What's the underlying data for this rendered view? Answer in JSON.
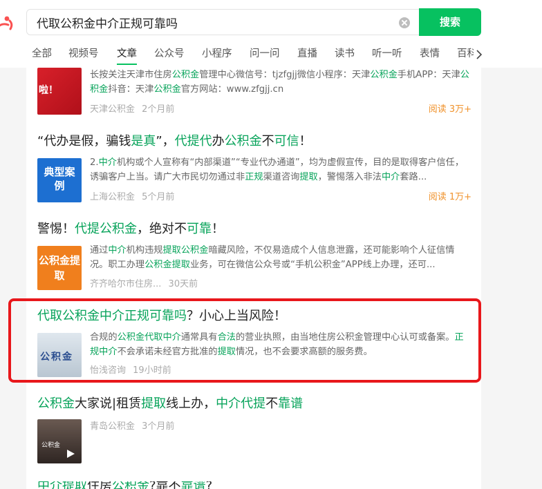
{
  "search": {
    "query": "代取公积金中介正规可靠吗",
    "button_label": "搜索"
  },
  "tabs": [
    "全部",
    "视频号",
    "文章",
    "公众号",
    "小程序",
    "问一问",
    "直播",
    "读书",
    "听一听",
    "表情",
    "百科"
  ],
  "active_tab": "文章",
  "colors": {
    "accent": "#07c160",
    "highlight": "#07a35a",
    "reads": "#f0922b",
    "annotation": "#e8171b"
  },
  "results": [
    {
      "title_parts": [],
      "snippet_parts": [
        {
          "t": "长按关注天津市住房",
          "h": false
        },
        {
          "t": "公积金",
          "h": true
        },
        {
          "t": "管理中心微信号：tjzfgjj微信小程序：天津",
          "h": false
        },
        {
          "t": "公积金",
          "h": true
        },
        {
          "t": "手机APP：天津",
          "h": false
        },
        {
          "t": "公积金",
          "h": true
        },
        {
          "t": "抖音：天津",
          "h": false
        },
        {
          "t": "公积金",
          "h": true
        },
        {
          "t": "官方网站：www.zfgjj.cn",
          "h": false
        }
      ],
      "source": "天津公积金",
      "time": "2个月前",
      "reads": "阅读 3万+",
      "thumb_text": "啦！"
    },
    {
      "title_parts": [
        {
          "t": "“代办是假，骗钱",
          "h": false
        },
        {
          "t": "是真",
          "h": true
        },
        {
          "t": "”，",
          "h": false
        },
        {
          "t": "代提代",
          "h": true
        },
        {
          "t": "办",
          "h": false
        },
        {
          "t": "公积金",
          "h": true
        },
        {
          "t": "不",
          "h": false
        },
        {
          "t": "可信",
          "h": true
        },
        {
          "t": "！",
          "h": false
        }
      ],
      "snippet_parts": [
        {
          "t": "2.",
          "h": false
        },
        {
          "t": "中介",
          "h": true
        },
        {
          "t": "机构或个人宣称有“内部渠道”“专业代办通道”，均为虚假宣传，目的是取得客户信任，诱骗客户上当。请广大市民切勿通过非",
          "h": false
        },
        {
          "t": "正规",
          "h": true
        },
        {
          "t": "渠道咨询",
          "h": false
        },
        {
          "t": "提取",
          "h": true
        },
        {
          "t": "，警惕落入非法",
          "h": false
        },
        {
          "t": "中介",
          "h": true
        },
        {
          "t": "套路...",
          "h": false
        }
      ],
      "source": "上海公积金",
      "time": "5个月前",
      "reads": "阅读 1万+",
      "thumb_text": "典型案例"
    },
    {
      "title_parts": [
        {
          "t": "警惕！",
          "h": false
        },
        {
          "t": "代提公积金",
          "h": true
        },
        {
          "t": "，绝对不",
          "h": false
        },
        {
          "t": "可靠",
          "h": true
        },
        {
          "t": "！",
          "h": false
        }
      ],
      "snippet_parts": [
        {
          "t": "通过",
          "h": false
        },
        {
          "t": "中介",
          "h": true
        },
        {
          "t": "机构违规",
          "h": false
        },
        {
          "t": "提取公积金",
          "h": true
        },
        {
          "t": "暗藏风险，不仅易造成个人信息泄露，还可能影响个人征信情况。职工办理",
          "h": false
        },
        {
          "t": "公积金提取",
          "h": true
        },
        {
          "t": "业务，可在微信公众号或“手机公积金”APP线上办理，还可...",
          "h": false
        }
      ],
      "source": "齐齐哈尔市住房...",
      "time": "30天前",
      "reads": "",
      "thumb_text": "公积金提取"
    },
    {
      "title_parts": [
        {
          "t": "代取公积金中介正规可靠吗",
          "h": true
        },
        {
          "t": "？小心上当风险！",
          "h": false
        }
      ],
      "snippet_parts": [
        {
          "t": "合规的",
          "h": false
        },
        {
          "t": "公积金代取中介",
          "h": true
        },
        {
          "t": "通常具有",
          "h": false
        },
        {
          "t": "合法",
          "h": true
        },
        {
          "t": "的营业执照，由当地住房公积金管理中心认可或备案。",
          "h": false
        },
        {
          "t": "正规中介",
          "h": true
        },
        {
          "t": "不会承诺未经官方批准的",
          "h": false
        },
        {
          "t": "提取",
          "h": true
        },
        {
          "t": "情况，也不会要求高额的服务费。",
          "h": false
        }
      ],
      "source": "怡浅咨询",
      "time": "19小时前",
      "reads": "",
      "thumb_text": "公积金"
    },
    {
      "title_parts": [
        {
          "t": "公积金",
          "h": true
        },
        {
          "t": "大家说|租赁",
          "h": false
        },
        {
          "t": "提取",
          "h": true
        },
        {
          "t": "线上办，",
          "h": false
        },
        {
          "t": "中介代提",
          "h": true
        },
        {
          "t": "不",
          "h": false
        },
        {
          "t": "靠谱",
          "h": true
        }
      ],
      "snippet_parts": [],
      "source": "青岛公积金",
      "time": "3个月前",
      "reads": "",
      "thumb_text": "公积金"
    },
    {
      "title_parts": [
        {
          "t": "中介提取",
          "h": true
        },
        {
          "t": "住房",
          "h": false
        },
        {
          "t": "公积金",
          "h": true
        },
        {
          "t": "?靠不",
          "h": false
        },
        {
          "t": "靠谱",
          "h": true
        },
        {
          "t": "?",
          "h": false
        }
      ],
      "snippet_parts": [],
      "source": "",
      "time": "",
      "reads": "",
      "thumb_text": ""
    }
  ]
}
